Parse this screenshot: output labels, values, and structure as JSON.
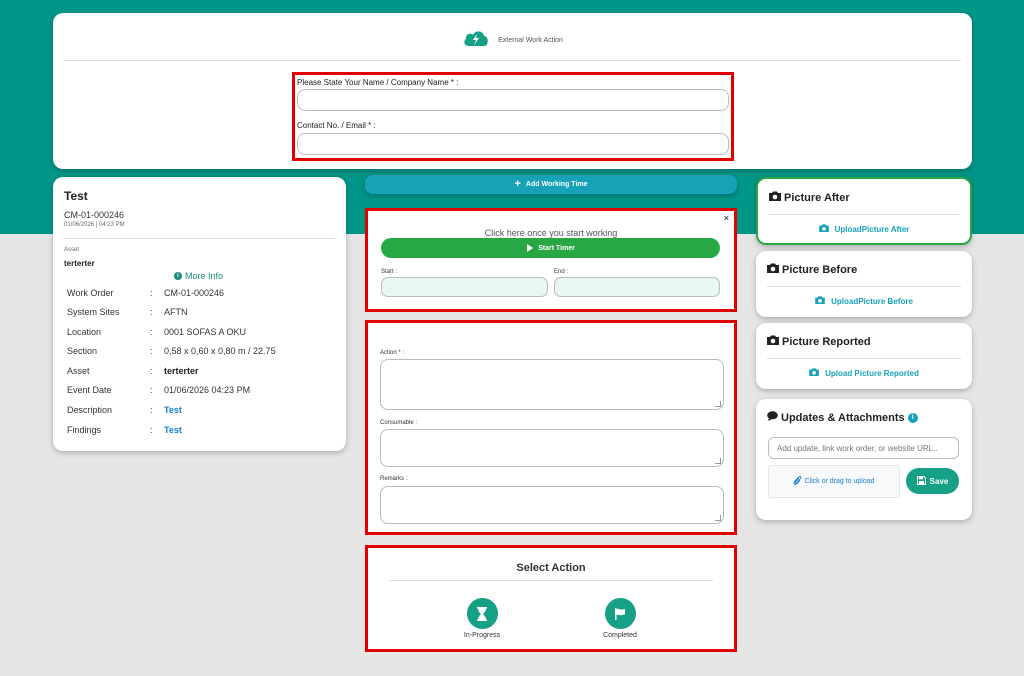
{
  "colors": {
    "teal_band": "#009688",
    "highlight_border": "#e00000",
    "start_timer": "#28a745",
    "add_working_time": "#17a2b8",
    "action_icon": "#16a085",
    "link_blue": "#1a7fd0"
  },
  "header": {
    "logo_icon": "cloud-bolt-icon",
    "title": "External Work Action",
    "name_label": "Please State Your Name / Company Name * :",
    "name_value": "",
    "contact_label": "Contact No. / Email * :",
    "contact_value": ""
  },
  "work_order": {
    "title": "Test",
    "number": "CM-01-000246",
    "date": "01/06/2026 | 04:23 PM",
    "asset_label": "Asset",
    "asset_value": "terterter",
    "more_info": "More Info",
    "rows": [
      {
        "key": "Work Order",
        "value": "CM-01-000246"
      },
      {
        "key": "System Sites",
        "value": "AFTN"
      },
      {
        "key": "Location",
        "value": "0001 SOFAS A OKU"
      },
      {
        "key": "Section",
        "value": "0,58 x 0,60 x 0,80 m / 22.75"
      },
      {
        "key": "Asset",
        "value": "terterter"
      },
      {
        "key": "Event Date",
        "value": "01/06/2026 04:23 PM"
      },
      {
        "key": "Description",
        "value": "Test"
      },
      {
        "key": "Findings",
        "value": "Test"
      }
    ]
  },
  "timer": {
    "add_working_time": "Add Working Time",
    "close": "×",
    "hint": "Click here once you start working",
    "start_button": "Start Timer",
    "start_label": "Start :",
    "end_label": "End :"
  },
  "action_form": {
    "action_label": "Action * :",
    "consumable_label": "Consumable :",
    "remarks_label": "Remarks :"
  },
  "select_action": {
    "title": "Select Action",
    "in_progress": "In-Progress",
    "completed": "Completed"
  },
  "pictures": {
    "after_title": "Picture After",
    "after_link": "UploadPicture After",
    "before_title": "Picture Before",
    "before_link": "UploadPicture Before",
    "reported_title": "Picture Reported",
    "reported_link": "Upload Picture Reported"
  },
  "updates": {
    "title": "Updates & Attachments",
    "placeholder": "Add update, link work order, or website URL..",
    "upload": "Click or drag to upload",
    "save": "Save"
  }
}
